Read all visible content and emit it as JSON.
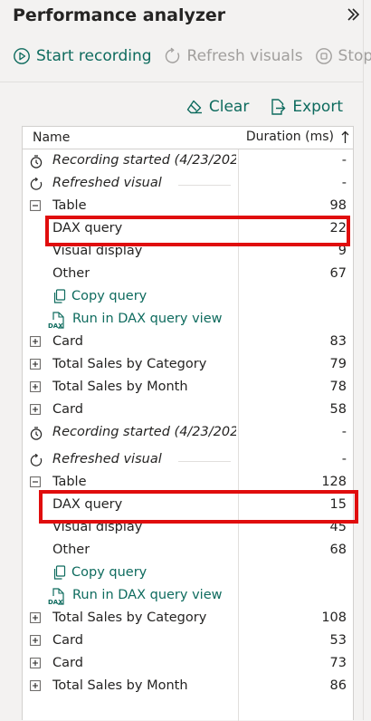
{
  "header": {
    "title": "Performance analyzer"
  },
  "toolbar": {
    "start_recording": "Start recording",
    "refresh_visuals": "Refresh visuals",
    "stop": "Stop"
  },
  "actions": {
    "clear": "Clear",
    "export": "Export"
  },
  "table": {
    "col_name": "Name",
    "col_duration": "Duration (ms)",
    "rows": [
      {
        "kind": "recording",
        "name": "Recording started (4/23/202...",
        "value": "-"
      },
      {
        "kind": "refreshed",
        "name": "Refreshed visual",
        "value": "-"
      },
      {
        "kind": "expanded",
        "name": "Table",
        "value": "98"
      },
      {
        "kind": "child",
        "name": "DAX query",
        "value": "22"
      },
      {
        "kind": "child",
        "name": "Visual display",
        "value": "9"
      },
      {
        "kind": "child",
        "name": "Other",
        "value": "67"
      },
      {
        "kind": "copy",
        "name": "Copy query",
        "value": ""
      },
      {
        "kind": "dax",
        "name": "Run in DAX query view",
        "value": ""
      },
      {
        "kind": "collapsed",
        "name": "Card",
        "value": "83"
      },
      {
        "kind": "collapsed",
        "name": "Total Sales by Category",
        "value": "79"
      },
      {
        "kind": "collapsed",
        "name": "Total Sales by Month",
        "value": "78"
      },
      {
        "kind": "collapsed",
        "name": "Card",
        "value": "58"
      },
      {
        "kind": "recording",
        "name": "Recording started (4/23/202...",
        "value": "-"
      },
      {
        "kind": "refreshed",
        "name": "Refreshed visual",
        "value": "-"
      },
      {
        "kind": "expanded",
        "name": "Table",
        "value": "128"
      },
      {
        "kind": "child",
        "name": "DAX query",
        "value": "15"
      },
      {
        "kind": "child",
        "name": "Visual display",
        "value": "45"
      },
      {
        "kind": "child",
        "name": "Other",
        "value": "68"
      },
      {
        "kind": "copy",
        "name": "Copy query",
        "value": ""
      },
      {
        "kind": "dax",
        "name": "Run in DAX query view",
        "value": ""
      },
      {
        "kind": "collapsed",
        "name": "Total Sales by Category",
        "value": "108"
      },
      {
        "kind": "collapsed",
        "name": "Card",
        "value": "53"
      },
      {
        "kind": "collapsed",
        "name": "Card",
        "value": "73"
      },
      {
        "kind": "collapsed",
        "name": "Total Sales by Month",
        "value": "86"
      }
    ]
  },
  "colors": {
    "accent": "#0e6b5e",
    "highlight": "#e00d0d",
    "disabled": "#a19f9d"
  }
}
